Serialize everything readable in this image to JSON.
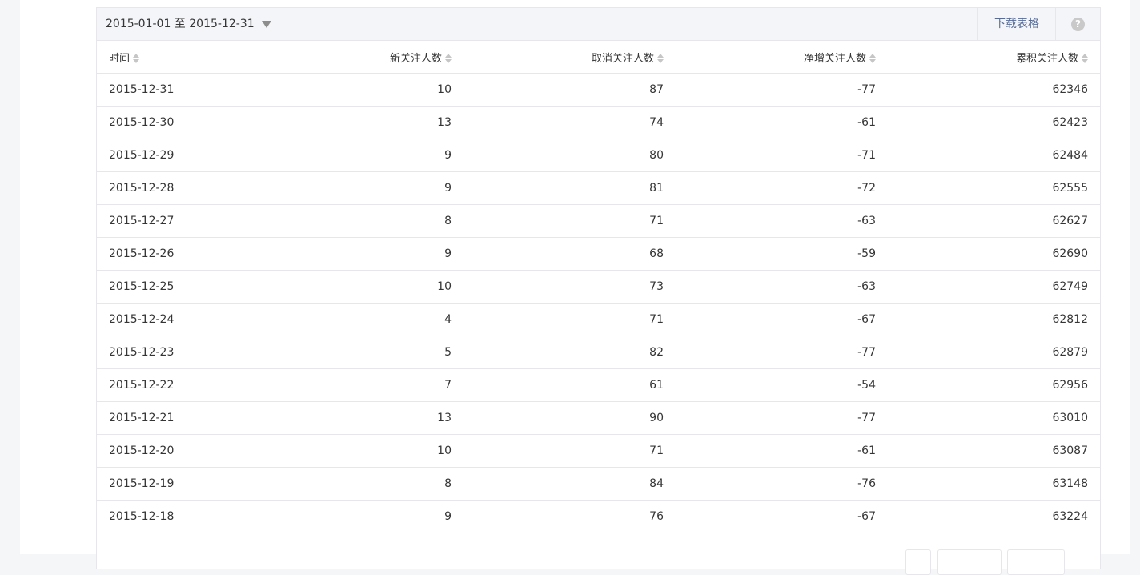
{
  "toolbar": {
    "date_range": "2015-01-01 至 2015-12-31",
    "download_label": "下载表格",
    "help_symbol": "?"
  },
  "table": {
    "columns": [
      "时间",
      "新关注人数",
      "取消关注人数",
      "净增关注人数",
      "累积关注人数"
    ],
    "rows": [
      [
        "2015-12-31",
        "10",
        "87",
        "-77",
        "62346"
      ],
      [
        "2015-12-30",
        "13",
        "74",
        "-61",
        "62423"
      ],
      [
        "2015-12-29",
        "9",
        "80",
        "-71",
        "62484"
      ],
      [
        "2015-12-28",
        "9",
        "81",
        "-72",
        "62555"
      ],
      [
        "2015-12-27",
        "8",
        "71",
        "-63",
        "62627"
      ],
      [
        "2015-12-26",
        "9",
        "68",
        "-59",
        "62690"
      ],
      [
        "2015-12-25",
        "10",
        "73",
        "-63",
        "62749"
      ],
      [
        "2015-12-24",
        "4",
        "71",
        "-67",
        "62812"
      ],
      [
        "2015-12-23",
        "5",
        "82",
        "-77",
        "62879"
      ],
      [
        "2015-12-22",
        "7",
        "61",
        "-54",
        "62956"
      ],
      [
        "2015-12-21",
        "13",
        "90",
        "-77",
        "63010"
      ],
      [
        "2015-12-20",
        "10",
        "71",
        "-61",
        "63087"
      ],
      [
        "2015-12-19",
        "8",
        "84",
        "-76",
        "63148"
      ],
      [
        "2015-12-18",
        "9",
        "76",
        "-67",
        "63224"
      ]
    ]
  },
  "colors": {
    "link": "#576b95",
    "border": "#e7e7eb",
    "toolbar_bg": "#f4f5f9"
  }
}
